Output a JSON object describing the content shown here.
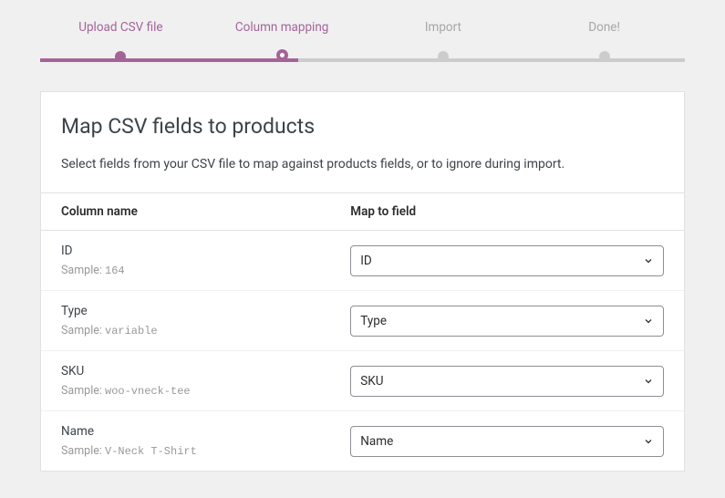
{
  "stepper": {
    "steps": [
      {
        "label": "Upload CSV file",
        "state": "done"
      },
      {
        "label": "Column mapping",
        "state": "active"
      },
      {
        "label": "Import",
        "state": "pending"
      },
      {
        "label": "Done!",
        "state": "pending"
      }
    ]
  },
  "panel": {
    "title": "Map CSV fields to products",
    "description": "Select fields from your CSV file to map against products fields, or to ignore during import."
  },
  "table": {
    "header_left": "Column name",
    "header_right": "Map to field",
    "sample_prefix": "Sample: ",
    "rows": [
      {
        "name": "ID",
        "sample": "164",
        "selected": "ID"
      },
      {
        "name": "Type",
        "sample": "variable",
        "selected": "Type"
      },
      {
        "name": "SKU",
        "sample": "woo-vneck-tee",
        "selected": "SKU"
      },
      {
        "name": "Name",
        "sample": "V-Neck T-Shirt",
        "selected": "Name"
      }
    ]
  }
}
